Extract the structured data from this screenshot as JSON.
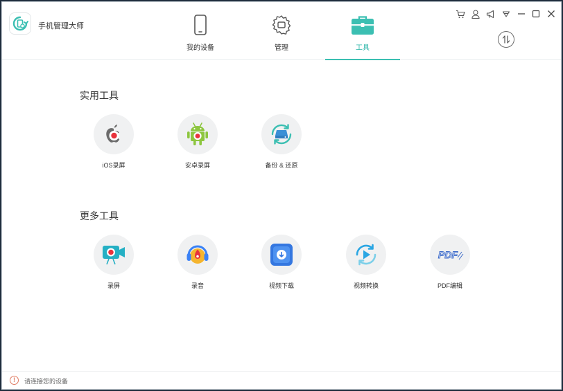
{
  "app": {
    "title": "手机管理大师"
  },
  "nav": {
    "tabs": [
      {
        "label": "我的设备",
        "icon": "phone-icon",
        "active": false
      },
      {
        "label": "管理",
        "icon": "gear-icon",
        "active": false
      },
      {
        "label": "工具",
        "icon": "toolbox-icon",
        "active": true
      }
    ]
  },
  "window_controls": [
    "cart-icon",
    "user-icon",
    "megaphone-icon",
    "dropdown-icon",
    "minimize-icon",
    "maximize-icon",
    "close-icon"
  ],
  "sections": {
    "practical": {
      "title": "实用工具",
      "tools": [
        {
          "label": "iOS录屏",
          "icon": "apple-record-icon"
        },
        {
          "label": "安卓录屏",
          "icon": "android-record-icon"
        },
        {
          "label": "备份 & 还原",
          "icon": "backup-restore-icon"
        }
      ]
    },
    "more": {
      "title": "更多工具",
      "tools": [
        {
          "label": "录屏",
          "icon": "screen-record-icon"
        },
        {
          "label": "录音",
          "icon": "audio-record-icon"
        },
        {
          "label": "视频下载",
          "icon": "video-download-icon"
        },
        {
          "label": "视频转换",
          "icon": "video-convert-icon"
        },
        {
          "label": "PDF编辑",
          "icon": "pdf-edit-icon"
        }
      ]
    }
  },
  "footer": {
    "status": "请连接您的设备"
  },
  "colors": {
    "accent": "#3bbfb2",
    "record_red": "#e8323c",
    "android_green": "#8dc63f",
    "blue": "#3b82f6"
  }
}
